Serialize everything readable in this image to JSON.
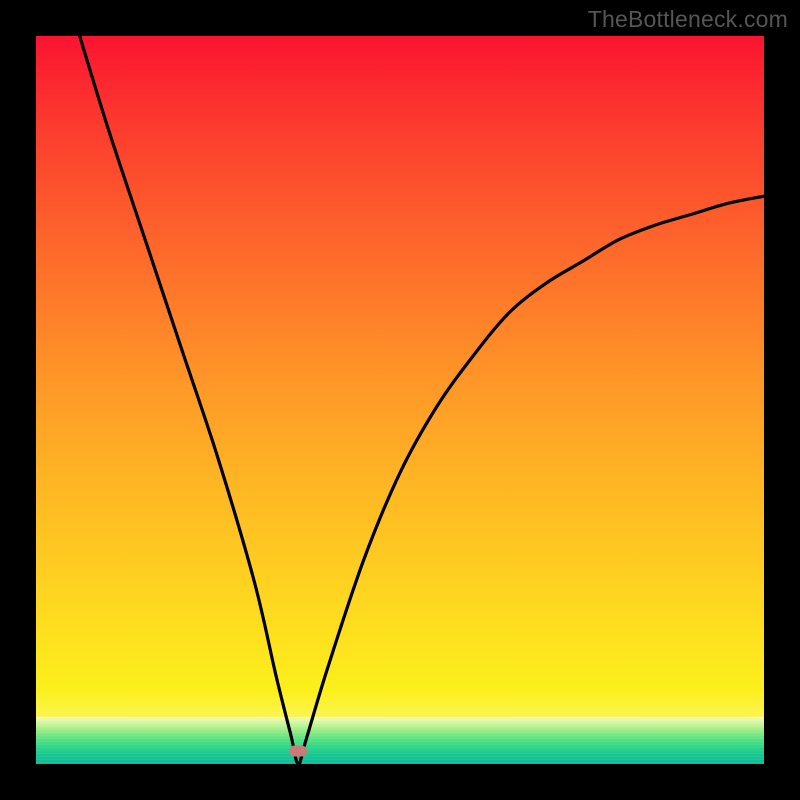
{
  "watermark": "TheBottleneck.com",
  "chart_data": {
    "type": "line",
    "title": "",
    "xlabel": "",
    "ylabel": "",
    "xlim": [
      0,
      100
    ],
    "ylim": [
      0,
      100
    ],
    "legend": false,
    "grid": false,
    "background_gradient": {
      "stops": [
        {
          "pos": 0.0,
          "color": "#fb1430"
        },
        {
          "pos": 0.5,
          "color": "#fe9f28"
        },
        {
          "pos": 0.9,
          "color": "#fcf01c"
        },
        {
          "pos": 0.97,
          "color": "#f8fccf"
        },
        {
          "pos": 1.0,
          "color": "#0fba9c"
        }
      ]
    },
    "series": [
      {
        "name": "bottleneck-curve",
        "x": [
          6,
          10,
          15,
          20,
          25,
          30,
          33,
          35,
          36,
          37,
          40,
          45,
          50,
          55,
          60,
          65,
          70,
          75,
          80,
          85,
          90,
          95,
          100
        ],
        "y": [
          100,
          87,
          72,
          57,
          42,
          25,
          12,
          4,
          0,
          3,
          13,
          28,
          40,
          49,
          56,
          62,
          66,
          69,
          72,
          74,
          75.5,
          77,
          78
        ]
      }
    ],
    "marker": {
      "name": "optimal-point",
      "x": 36,
      "y": 1.8,
      "color": "#ca7a78"
    }
  }
}
